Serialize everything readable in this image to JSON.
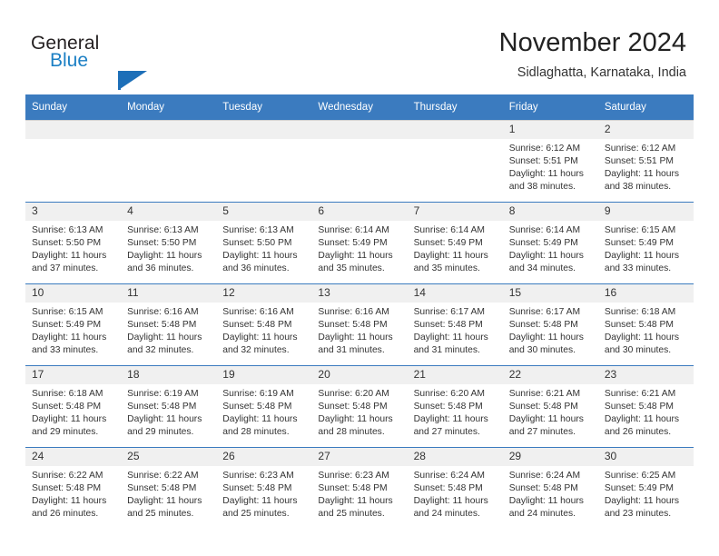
{
  "brand": {
    "line1": "General",
    "line2": "Blue",
    "flag_icon": "triangle-flag-icon",
    "accent_color": "#1d6fb8"
  },
  "header": {
    "title": "November 2024",
    "subtitle": "Sidlaghatta, Karnataka, India"
  },
  "colors": {
    "header_blue": "#3b7bbf",
    "daynum_band": "#f0f0f0",
    "text": "#333333"
  },
  "weekday_headers": [
    "Sunday",
    "Monday",
    "Tuesday",
    "Wednesday",
    "Thursday",
    "Friday",
    "Saturday"
  ],
  "weeks": [
    [
      {
        "day": "",
        "empty": true
      },
      {
        "day": "",
        "empty": true
      },
      {
        "day": "",
        "empty": true
      },
      {
        "day": "",
        "empty": true
      },
      {
        "day": "",
        "empty": true
      },
      {
        "day": "1",
        "sunrise": "Sunrise: 6:12 AM",
        "sunset": "Sunset: 5:51 PM",
        "daylight1": "Daylight: 11 hours",
        "daylight2": "and 38 minutes."
      },
      {
        "day": "2",
        "sunrise": "Sunrise: 6:12 AM",
        "sunset": "Sunset: 5:51 PM",
        "daylight1": "Daylight: 11 hours",
        "daylight2": "and 38 minutes."
      }
    ],
    [
      {
        "day": "3",
        "sunrise": "Sunrise: 6:13 AM",
        "sunset": "Sunset: 5:50 PM",
        "daylight1": "Daylight: 11 hours",
        "daylight2": "and 37 minutes."
      },
      {
        "day": "4",
        "sunrise": "Sunrise: 6:13 AM",
        "sunset": "Sunset: 5:50 PM",
        "daylight1": "Daylight: 11 hours",
        "daylight2": "and 36 minutes."
      },
      {
        "day": "5",
        "sunrise": "Sunrise: 6:13 AM",
        "sunset": "Sunset: 5:50 PM",
        "daylight1": "Daylight: 11 hours",
        "daylight2": "and 36 minutes."
      },
      {
        "day": "6",
        "sunrise": "Sunrise: 6:14 AM",
        "sunset": "Sunset: 5:49 PM",
        "daylight1": "Daylight: 11 hours",
        "daylight2": "and 35 minutes."
      },
      {
        "day": "7",
        "sunrise": "Sunrise: 6:14 AM",
        "sunset": "Sunset: 5:49 PM",
        "daylight1": "Daylight: 11 hours",
        "daylight2": "and 35 minutes."
      },
      {
        "day": "8",
        "sunrise": "Sunrise: 6:14 AM",
        "sunset": "Sunset: 5:49 PM",
        "daylight1": "Daylight: 11 hours",
        "daylight2": "and 34 minutes."
      },
      {
        "day": "9",
        "sunrise": "Sunrise: 6:15 AM",
        "sunset": "Sunset: 5:49 PM",
        "daylight1": "Daylight: 11 hours",
        "daylight2": "and 33 minutes."
      }
    ],
    [
      {
        "day": "10",
        "sunrise": "Sunrise: 6:15 AM",
        "sunset": "Sunset: 5:49 PM",
        "daylight1": "Daylight: 11 hours",
        "daylight2": "and 33 minutes."
      },
      {
        "day": "11",
        "sunrise": "Sunrise: 6:16 AM",
        "sunset": "Sunset: 5:48 PM",
        "daylight1": "Daylight: 11 hours",
        "daylight2": "and 32 minutes."
      },
      {
        "day": "12",
        "sunrise": "Sunrise: 6:16 AM",
        "sunset": "Sunset: 5:48 PM",
        "daylight1": "Daylight: 11 hours",
        "daylight2": "and 32 minutes."
      },
      {
        "day": "13",
        "sunrise": "Sunrise: 6:16 AM",
        "sunset": "Sunset: 5:48 PM",
        "daylight1": "Daylight: 11 hours",
        "daylight2": "and 31 minutes."
      },
      {
        "day": "14",
        "sunrise": "Sunrise: 6:17 AM",
        "sunset": "Sunset: 5:48 PM",
        "daylight1": "Daylight: 11 hours",
        "daylight2": "and 31 minutes."
      },
      {
        "day": "15",
        "sunrise": "Sunrise: 6:17 AM",
        "sunset": "Sunset: 5:48 PM",
        "daylight1": "Daylight: 11 hours",
        "daylight2": "and 30 minutes."
      },
      {
        "day": "16",
        "sunrise": "Sunrise: 6:18 AM",
        "sunset": "Sunset: 5:48 PM",
        "daylight1": "Daylight: 11 hours",
        "daylight2": "and 30 minutes."
      }
    ],
    [
      {
        "day": "17",
        "sunrise": "Sunrise: 6:18 AM",
        "sunset": "Sunset: 5:48 PM",
        "daylight1": "Daylight: 11 hours",
        "daylight2": "and 29 minutes."
      },
      {
        "day": "18",
        "sunrise": "Sunrise: 6:19 AM",
        "sunset": "Sunset: 5:48 PM",
        "daylight1": "Daylight: 11 hours",
        "daylight2": "and 29 minutes."
      },
      {
        "day": "19",
        "sunrise": "Sunrise: 6:19 AM",
        "sunset": "Sunset: 5:48 PM",
        "daylight1": "Daylight: 11 hours",
        "daylight2": "and 28 minutes."
      },
      {
        "day": "20",
        "sunrise": "Sunrise: 6:20 AM",
        "sunset": "Sunset: 5:48 PM",
        "daylight1": "Daylight: 11 hours",
        "daylight2": "and 28 minutes."
      },
      {
        "day": "21",
        "sunrise": "Sunrise: 6:20 AM",
        "sunset": "Sunset: 5:48 PM",
        "daylight1": "Daylight: 11 hours",
        "daylight2": "and 27 minutes."
      },
      {
        "day": "22",
        "sunrise": "Sunrise: 6:21 AM",
        "sunset": "Sunset: 5:48 PM",
        "daylight1": "Daylight: 11 hours",
        "daylight2": "and 27 minutes."
      },
      {
        "day": "23",
        "sunrise": "Sunrise: 6:21 AM",
        "sunset": "Sunset: 5:48 PM",
        "daylight1": "Daylight: 11 hours",
        "daylight2": "and 26 minutes."
      }
    ],
    [
      {
        "day": "24",
        "sunrise": "Sunrise: 6:22 AM",
        "sunset": "Sunset: 5:48 PM",
        "daylight1": "Daylight: 11 hours",
        "daylight2": "and 26 minutes."
      },
      {
        "day": "25",
        "sunrise": "Sunrise: 6:22 AM",
        "sunset": "Sunset: 5:48 PM",
        "daylight1": "Daylight: 11 hours",
        "daylight2": "and 25 minutes."
      },
      {
        "day": "26",
        "sunrise": "Sunrise: 6:23 AM",
        "sunset": "Sunset: 5:48 PM",
        "daylight1": "Daylight: 11 hours",
        "daylight2": "and 25 minutes."
      },
      {
        "day": "27",
        "sunrise": "Sunrise: 6:23 AM",
        "sunset": "Sunset: 5:48 PM",
        "daylight1": "Daylight: 11 hours",
        "daylight2": "and 25 minutes."
      },
      {
        "day": "28",
        "sunrise": "Sunrise: 6:24 AM",
        "sunset": "Sunset: 5:48 PM",
        "daylight1": "Daylight: 11 hours",
        "daylight2": "and 24 minutes."
      },
      {
        "day": "29",
        "sunrise": "Sunrise: 6:24 AM",
        "sunset": "Sunset: 5:48 PM",
        "daylight1": "Daylight: 11 hours",
        "daylight2": "and 24 minutes."
      },
      {
        "day": "30",
        "sunrise": "Sunrise: 6:25 AM",
        "sunset": "Sunset: 5:49 PM",
        "daylight1": "Daylight: 11 hours",
        "daylight2": "and 23 minutes."
      }
    ]
  ]
}
